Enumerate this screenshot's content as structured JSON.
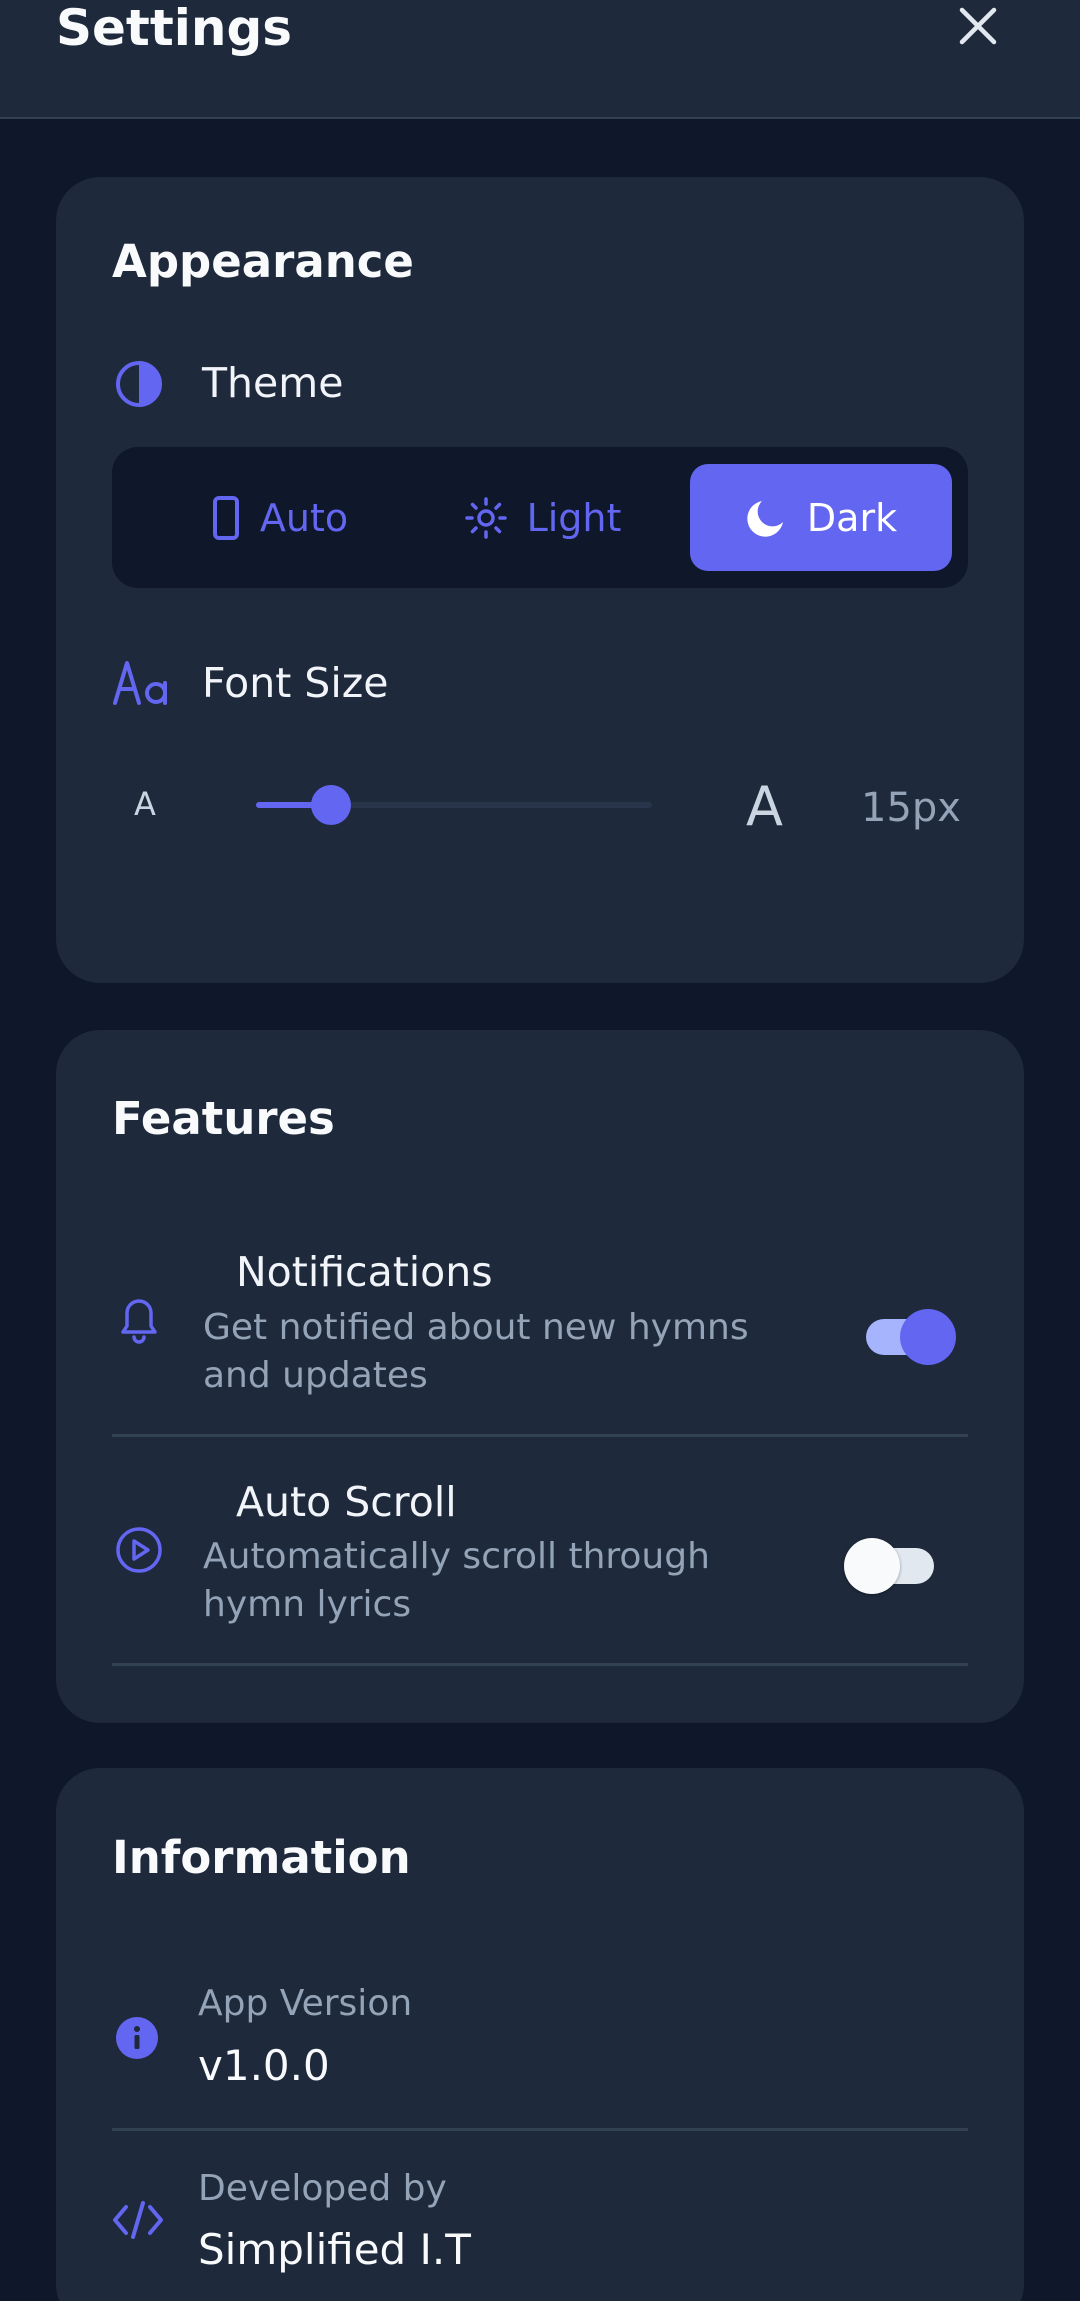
{
  "header": {
    "title": "Settings"
  },
  "appearance": {
    "title": "Appearance",
    "theme_label": "Theme",
    "theme_options": [
      {
        "label": "Auto",
        "icon": "phone-icon",
        "active": false
      },
      {
        "label": "Light",
        "icon": "sun-icon",
        "active": false
      },
      {
        "label": "Dark",
        "icon": "moon-icon",
        "active": true
      }
    ],
    "font_size_label": "Font Size",
    "font_size_small_a": "A",
    "font_size_large_a": "A",
    "font_size_value": "15px",
    "font_size_slider_fraction": 0.19
  },
  "features": {
    "title": "Features",
    "items": [
      {
        "title": "Notifications",
        "description": "Get notified about new hymns and updates",
        "icon": "bell-icon",
        "enabled": true
      },
      {
        "title": "Auto Scroll",
        "description": "Automatically scroll through hymn lyrics",
        "icon": "play-circle-icon",
        "enabled": false
      }
    ]
  },
  "information": {
    "title": "Information",
    "items": [
      {
        "label": "App Version",
        "value": "v1.0.0",
        "icon": "info-icon"
      },
      {
        "label": "Developed by",
        "value": "Simplified I.T",
        "icon": "code-icon"
      }
    ]
  },
  "colors": {
    "accent": "#6366f1",
    "background": "#0f172a",
    "card": "#1e293b"
  }
}
